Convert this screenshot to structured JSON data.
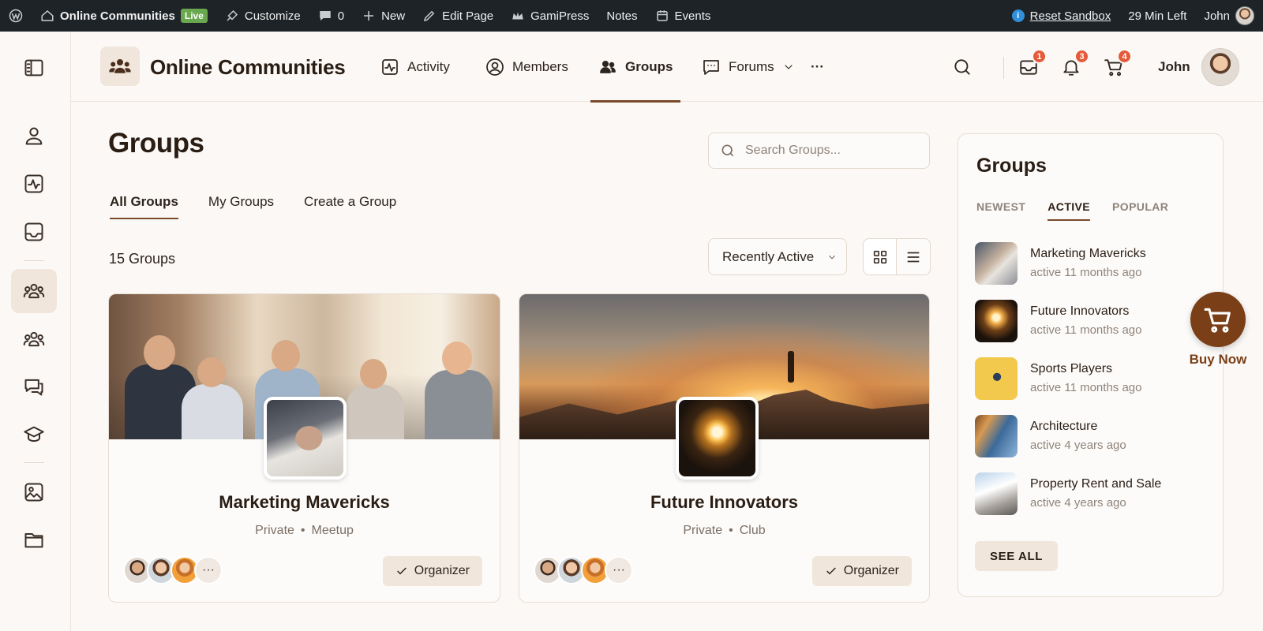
{
  "adminbar": {
    "site_name": "Online Communities",
    "live_label": "Live",
    "customize": "Customize",
    "comments_count": "0",
    "new": "New",
    "edit_page": "Edit Page",
    "gamipress": "GamiPress",
    "notes": "Notes",
    "events": "Events",
    "info": "i",
    "reset_sandbox": "Reset Sandbox",
    "time_left": "29 Min Left",
    "user": "John"
  },
  "topnav": {
    "brand": "Online Communities",
    "items": [
      {
        "label": "Activity",
        "icon": "activity-icon"
      },
      {
        "label": "Members",
        "icon": "user-circle-icon"
      },
      {
        "label": "Groups",
        "icon": "users-icon",
        "active": true
      },
      {
        "label": "Forums",
        "icon": "chat-icon"
      }
    ],
    "more": "···",
    "messages_badge": "1",
    "notifications_badge": "3",
    "cart_badge": "4",
    "user_name": "John"
  },
  "main": {
    "title": "Groups",
    "search_placeholder": "Search Groups...",
    "tabs": [
      "All Groups",
      "My Groups",
      "Create a Group"
    ],
    "count_label": "15 Groups",
    "sort_value": "Recently Active"
  },
  "cards": [
    {
      "name": "Marketing Mavericks",
      "privacy": "Private",
      "type": "Meetup",
      "more": "···",
      "role": "Organizer"
    },
    {
      "name": "Future Innovators",
      "privacy": "Private",
      "type": "Club",
      "more": "···",
      "role": "Organizer"
    }
  ],
  "widget": {
    "title": "Groups",
    "tabs": [
      "NEWEST",
      "ACTIVE",
      "POPULAR"
    ],
    "active_tab": "ACTIVE",
    "items": [
      {
        "name": "Marketing Mavericks",
        "time": "active 11 months ago"
      },
      {
        "name": "Future Innovators",
        "time": "active 11 months ago"
      },
      {
        "name": "Sports Players",
        "time": "active 11 months ago"
      },
      {
        "name": "Architecture",
        "time": "active 4 years ago"
      },
      {
        "name": "Property Rent and Sale",
        "time": "active 4 years ago"
      }
    ],
    "see_all": "SEE ALL"
  },
  "buy_now": "Buy Now",
  "colors": {
    "accent": "#7a4a2b",
    "buy_button": "#7a3f17",
    "badge": "#e45a3a",
    "adminbar_bg": "#1d2327"
  }
}
